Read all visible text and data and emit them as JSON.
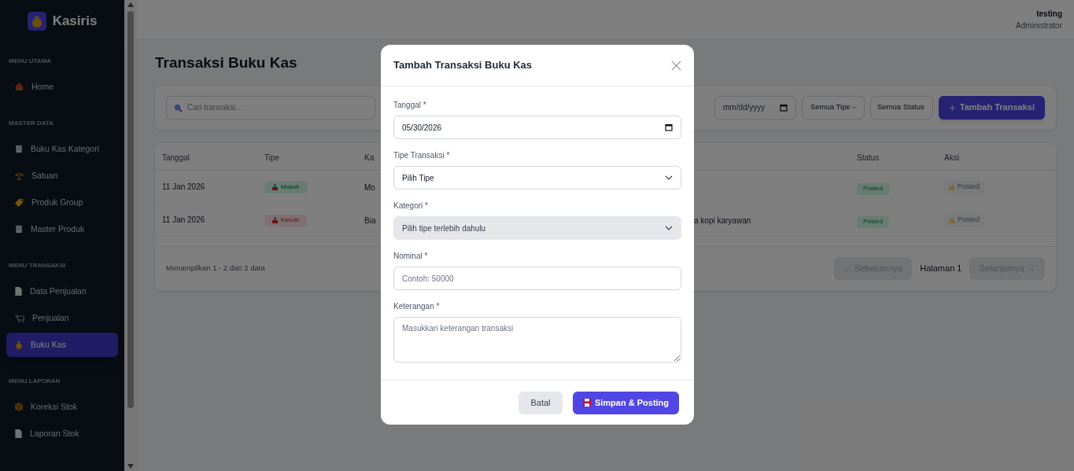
{
  "app": {
    "name": "Kasiris"
  },
  "user": {
    "name": "testing",
    "role": "Administrator"
  },
  "sidebar": {
    "sections": [
      {
        "title": "MENU UTAMA",
        "items": [
          {
            "label": "Home",
            "selected": false
          }
        ]
      },
      {
        "title": "MASTER DATA",
        "items": [
          {
            "label": "Buku Kas Kategori",
            "selected": false
          },
          {
            "label": "Satuan",
            "selected": false
          },
          {
            "label": "Produk Group",
            "selected": false
          },
          {
            "label": "Master Produk",
            "selected": false
          }
        ]
      },
      {
        "title": "MENU TRANSAKSI",
        "items": [
          {
            "label": "Data Penjualan",
            "selected": false
          },
          {
            "label": "Penjualan",
            "selected": false
          },
          {
            "label": "Buku Kas",
            "selected": true
          }
        ]
      },
      {
        "title": "MENU LAPORAN",
        "items": [
          {
            "label": "Koreksi Stok",
            "selected": false
          },
          {
            "label": "Laporan Stok",
            "selected": false
          }
        ]
      }
    ]
  },
  "page": {
    "title": "Transaksi Buku Kas"
  },
  "filters": {
    "search": {
      "placeholder": "Cari transaksi..."
    },
    "date": {
      "placeholder": "mm/dd/yyyy"
    },
    "type_select": {
      "value": "Semua Tipe"
    },
    "status_select": {
      "value": "Semua Status"
    },
    "add_button": {
      "label": "Tambah Transaksi",
      "icon": "+"
    }
  },
  "table": {
    "columns": [
      "Tanggal",
      "Tipe",
      "Ka",
      "",
      "Status",
      "Aksi"
    ],
    "rows": [
      {
        "tanggal": "11 Jan 2026",
        "tipe": {
          "label": "Masuk",
          "kind": "in"
        },
        "column_3": "Mo",
        "column_4": "",
        "status": "Posted",
        "aksi": {
          "label": "Posted",
          "disabled": true
        }
      },
      {
        "tanggal": "11 Jan 2026",
        "tipe": {
          "label": "Keluar",
          "kind": "out"
        },
        "column_3": "Bia",
        "column_4": "a kopi karyawan",
        "status": "Posted",
        "aksi": {
          "label": "Posted",
          "disabled": true
        }
      }
    ]
  },
  "pagination": {
    "summary": "Menampilkan 1 - 2 dari 2 data",
    "prev": {
      "label": "← Sebelumnya",
      "disabled": true
    },
    "page": "Halaman 1",
    "next": {
      "label": "Selanjutnya →",
      "disabled": true
    }
  },
  "modal": {
    "title": "Tambah Transaksi Buku Kas",
    "fields": [
      {
        "kind": "date",
        "label": "Tanggal *",
        "value": "05/30/2026",
        "disabled": false
      },
      {
        "kind": "select",
        "label": "Tipe Transaksi *",
        "value": "Pilih Tipe",
        "disabled": false
      },
      {
        "kind": "select",
        "label": "Kategori *",
        "value": "Pilih tipe terlebih dahulu",
        "disabled": true
      },
      {
        "kind": "text",
        "label": "Nominal *",
        "placeholder": "Contoh: 50000",
        "disabled": false
      },
      {
        "kind": "textarea",
        "label": "Keterangan *",
        "placeholder": "Masukkan keterangan transaksi",
        "disabled": false
      }
    ],
    "cancel": "Batal",
    "submit": "Simpan & Posting"
  }
}
